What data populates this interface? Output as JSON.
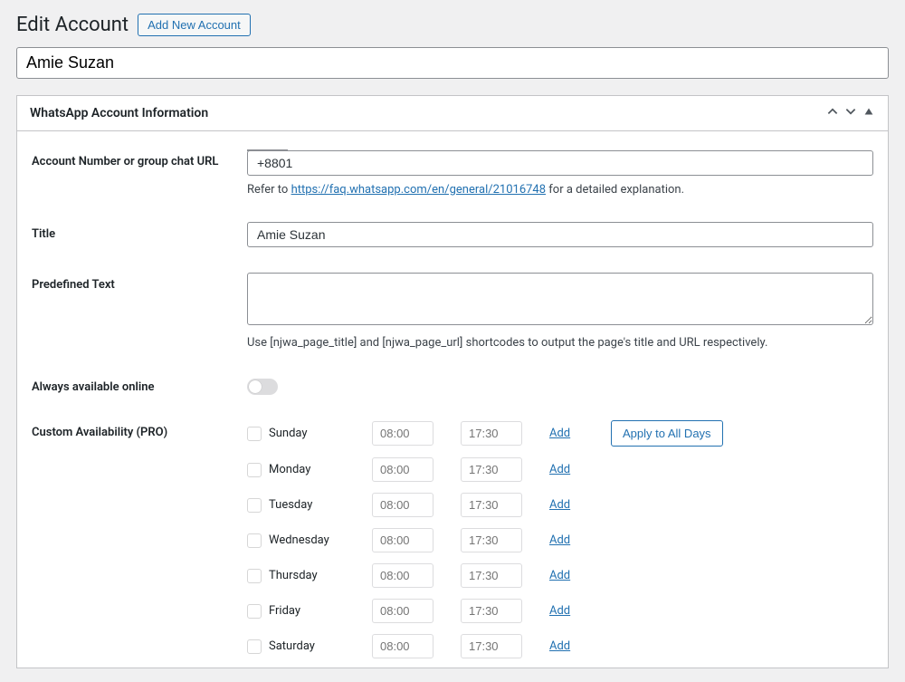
{
  "header": {
    "title": "Edit Account",
    "add_new_label": "Add New Account"
  },
  "account_name": "Amie Suzan",
  "panel": {
    "title": "WhatsApp Account Information"
  },
  "fields": {
    "account_number": {
      "label": "Account Number or group chat URL",
      "value": "+8801",
      "hint_prefix": "Refer to ",
      "hint_link": "https://faq.whatsapp.com/en/general/21016748",
      "hint_suffix": " for a detailed explanation."
    },
    "title": {
      "label": "Title",
      "value": "Amie Suzan"
    },
    "predefined": {
      "label": "Predefined Text",
      "value": "",
      "hint": "Use [njwa_page_title] and [njwa_page_url] shortcodes to output the page's title and URL respectively."
    },
    "always_online": {
      "label": "Always available online"
    },
    "custom_avail": {
      "label": "Custom Availability (PRO)",
      "apply_all": "Apply to All Days",
      "add_label": "Add",
      "days": [
        {
          "name": "Sunday",
          "from": "08:00",
          "to": "17:30"
        },
        {
          "name": "Monday",
          "from": "08:00",
          "to": "17:30"
        },
        {
          "name": "Tuesday",
          "from": "08:00",
          "to": "17:30"
        },
        {
          "name": "Wednesday",
          "from": "08:00",
          "to": "17:30"
        },
        {
          "name": "Thursday",
          "from": "08:00",
          "to": "17:30"
        },
        {
          "name": "Friday",
          "from": "08:00",
          "to": "17:30"
        },
        {
          "name": "Saturday",
          "from": "08:00",
          "to": "17:30"
        }
      ]
    }
  }
}
